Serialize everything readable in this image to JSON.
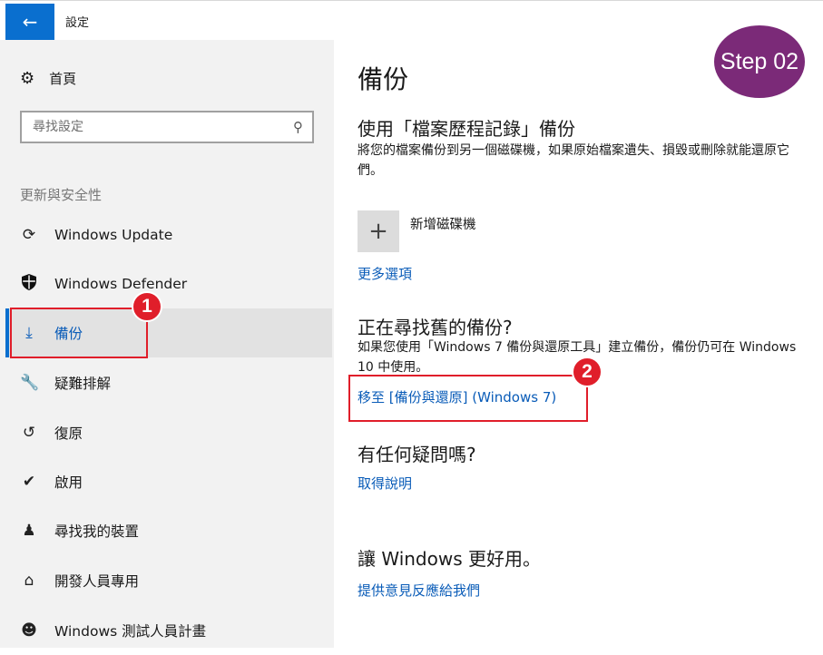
{
  "window": {
    "title": "設定",
    "back_icon": "arrow-left-icon"
  },
  "sidebar": {
    "home_label": "首頁",
    "search_placeholder": "尋找設定",
    "section_header": "更新與安全性",
    "items": [
      {
        "label": "Windows Update",
        "icon": "sync-icon",
        "selected": false
      },
      {
        "label": "Windows Defender",
        "icon": "shield-icon",
        "selected": false
      },
      {
        "label": "備份",
        "icon": "backup-arrow-icon",
        "selected": true
      },
      {
        "label": "疑難排解",
        "icon": "wrench-icon",
        "selected": false
      },
      {
        "label": "復原",
        "icon": "history-icon",
        "selected": false
      },
      {
        "label": "啟用",
        "icon": "check-circle-icon",
        "selected": false
      },
      {
        "label": "尋找我的裝置",
        "icon": "person-location-icon",
        "selected": false
      },
      {
        "label": "開發人員專用",
        "icon": "developer-tools-icon",
        "selected": false
      },
      {
        "label": "Windows 測試人員計畫",
        "icon": "insider-user-icon",
        "selected": false
      }
    ]
  },
  "main": {
    "title": "備份",
    "file_history_heading": "使用「檔案歷程記錄」備份",
    "file_history_desc": "將您的檔案備份到另一個磁碟機，如果原始檔案遺失、損毀或刪除就能還原它們。",
    "add_drive_label": "新增磁碟機",
    "more_options_link": "更多選項",
    "old_backup_heading": "正在尋找舊的備份?",
    "old_backup_desc": "如果您使用「Windows 7 備份與還原工具」建立備份，備份仍可在 Windows 10 中使用。",
    "go_to_backup_link": "移至 [備份與還原] (Windows 7)",
    "questions_heading": "有任何疑問嗎?",
    "get_help_link": "取得說明",
    "improve_heading": "讓 Windows 更好用。",
    "feedback_link": "提供意見反應給我們"
  },
  "annotations": {
    "step_label": "Step 02",
    "badge_1": "1",
    "badge_2": "2",
    "highlight_color": "#e01e2a",
    "step_color": "#7b2a78"
  },
  "colors": {
    "accent": "#0a6fcf",
    "link": "#0a5cb8",
    "sidebar_bg": "#f2f2f2"
  }
}
